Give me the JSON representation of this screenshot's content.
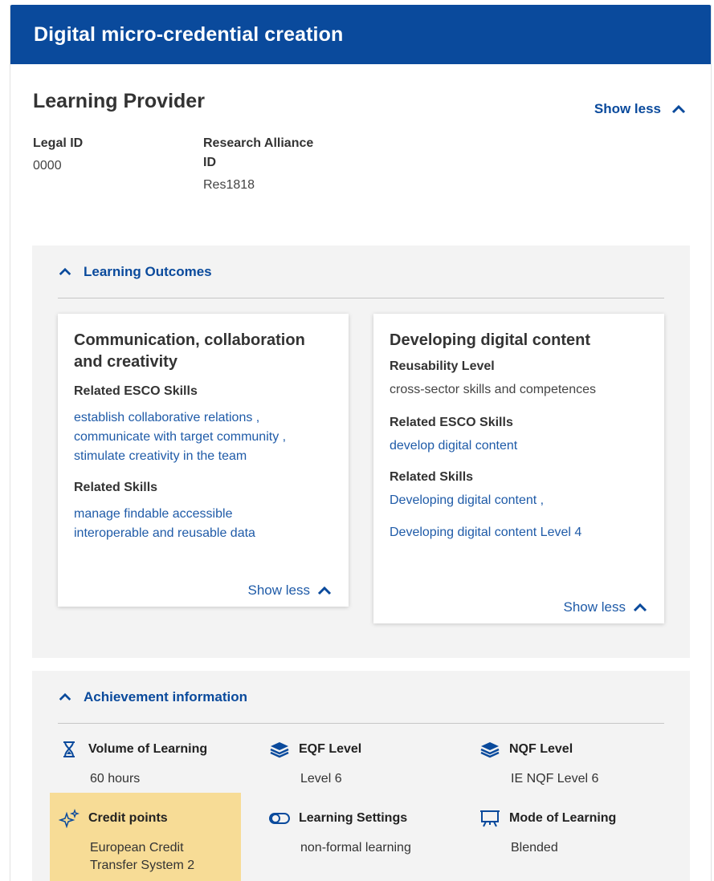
{
  "header": {
    "title": "Digital micro-credential creation"
  },
  "provider": {
    "heading": "Learning Provider",
    "toggle_label": "Show less",
    "legal_id_label": "Legal ID",
    "legal_id_value": "0000",
    "research_label_line1": "Research Alliance",
    "research_label_line2": "ID",
    "research_value": "Res1818"
  },
  "learning_outcomes": {
    "title": "Learning Outcomes",
    "cards": [
      {
        "title_line1": "Communication, collaboration",
        "title_line2": "and creativity",
        "esco_label": "Related ESCO Skills",
        "esco_links": [
          "establish collaborative relations ,",
          "communicate with target community ,",
          "stimulate creativity in the team"
        ],
        "skills_label": "Related Skills",
        "skills_links": [
          "manage findable accessible",
          "interoperable and reusable data"
        ],
        "toggle_label": "Show less"
      },
      {
        "title": "Developing digital content",
        "reusability_label": "Reusability Level",
        "reusability_value": "cross-sector skills and competences",
        "esco_label": "Related ESCO Skills",
        "esco_link": "develop digital content",
        "skills_label": "Related Skills",
        "skills_links": [
          "Developing digital content ,",
          "Developing digital content Level 4"
        ],
        "toggle_label": "Show less"
      }
    ]
  },
  "achievement": {
    "title": "Achievement information",
    "items": [
      {
        "label": "Volume of Learning",
        "value": "60 hours",
        "icon": "hourglass-icon"
      },
      {
        "label": "EQF Level",
        "value": "Level 6",
        "icon": "layers-icon"
      },
      {
        "label": "NQF Level",
        "value": "IE NQF Level 6",
        "icon": "layers-icon"
      },
      {
        "label": "Credit points",
        "value_line1": "European Credit",
        "value_line2": "Transfer System 2",
        "icon": "sparkles-icon"
      },
      {
        "label": "Learning Settings",
        "value": "non-formal learning",
        "icon": "toggle-icon"
      },
      {
        "label": "Mode of Learning",
        "value": "Blended",
        "icon": "presentation-board-icon"
      }
    ]
  },
  "colors": {
    "brand": "#0a4a9c",
    "link": "#1f5ba8",
    "highlight": "#f7dc96",
    "panel_bg": "#f3f3f3"
  }
}
